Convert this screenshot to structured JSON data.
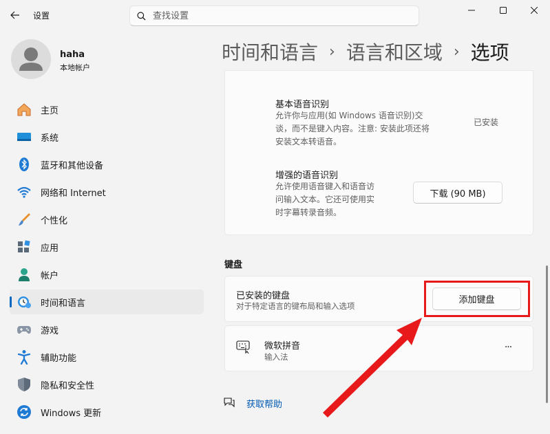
{
  "window": {
    "title": "设置",
    "minimize_label": "—",
    "maximize_label": "☐",
    "close_label": "✕"
  },
  "search": {
    "placeholder": "查找设置",
    "value": ""
  },
  "profile": {
    "name": "haha",
    "account_type": "本地帐户"
  },
  "nav": {
    "items": [
      {
        "label": "主页",
        "icon": "home-icon"
      },
      {
        "label": "系统",
        "icon": "system-icon"
      },
      {
        "label": "蓝牙和其他设备",
        "icon": "bluetooth-icon"
      },
      {
        "label": "网络和 Internet",
        "icon": "wifi-icon"
      },
      {
        "label": "个性化",
        "icon": "brush-icon"
      },
      {
        "label": "应用",
        "icon": "apps-icon"
      },
      {
        "label": "帐户",
        "icon": "account-icon"
      },
      {
        "label": "时间和语言",
        "icon": "time-language-icon",
        "active": true
      },
      {
        "label": "游戏",
        "icon": "gamepad-icon"
      },
      {
        "label": "辅助功能",
        "icon": "accessibility-icon"
      },
      {
        "label": "隐私和安全性",
        "icon": "shield-icon"
      },
      {
        "label": "Windows 更新",
        "icon": "update-icon"
      }
    ]
  },
  "breadcrumb": {
    "level1": "时间和语言",
    "level2": "语言和区域",
    "level3": "选项",
    "separator": "›"
  },
  "speech": {
    "basic": {
      "title": "基本语音识别",
      "desc_lines": [
        "允许你与应用(如 Windows 语音识别)交",
        "谈，而不是键入内容。注意: 安装此项还将",
        "安装文本转语音。"
      ],
      "status": "已安装"
    },
    "enhanced": {
      "title": "增强的语音识别",
      "desc_lines": [
        "允许使用语音键入和语音访",
        "问输入文本。它还可使用实",
        "时字幕转录音频。"
      ],
      "button": "下载 (90 MB)"
    }
  },
  "keyboard": {
    "section_title": "键盘",
    "installed_title": "已安装的键盘",
    "installed_desc": "对于特定语言的键布局和输入选项",
    "add_button": "添加键盘",
    "items": [
      {
        "name": "微软拼音",
        "type": "输入法",
        "more": "···"
      }
    ]
  },
  "help": {
    "label": "获取帮助"
  },
  "annotation": {
    "color": "#e8191b"
  },
  "colors": {
    "accent": "#0067c0",
    "link": "#0059b3"
  }
}
